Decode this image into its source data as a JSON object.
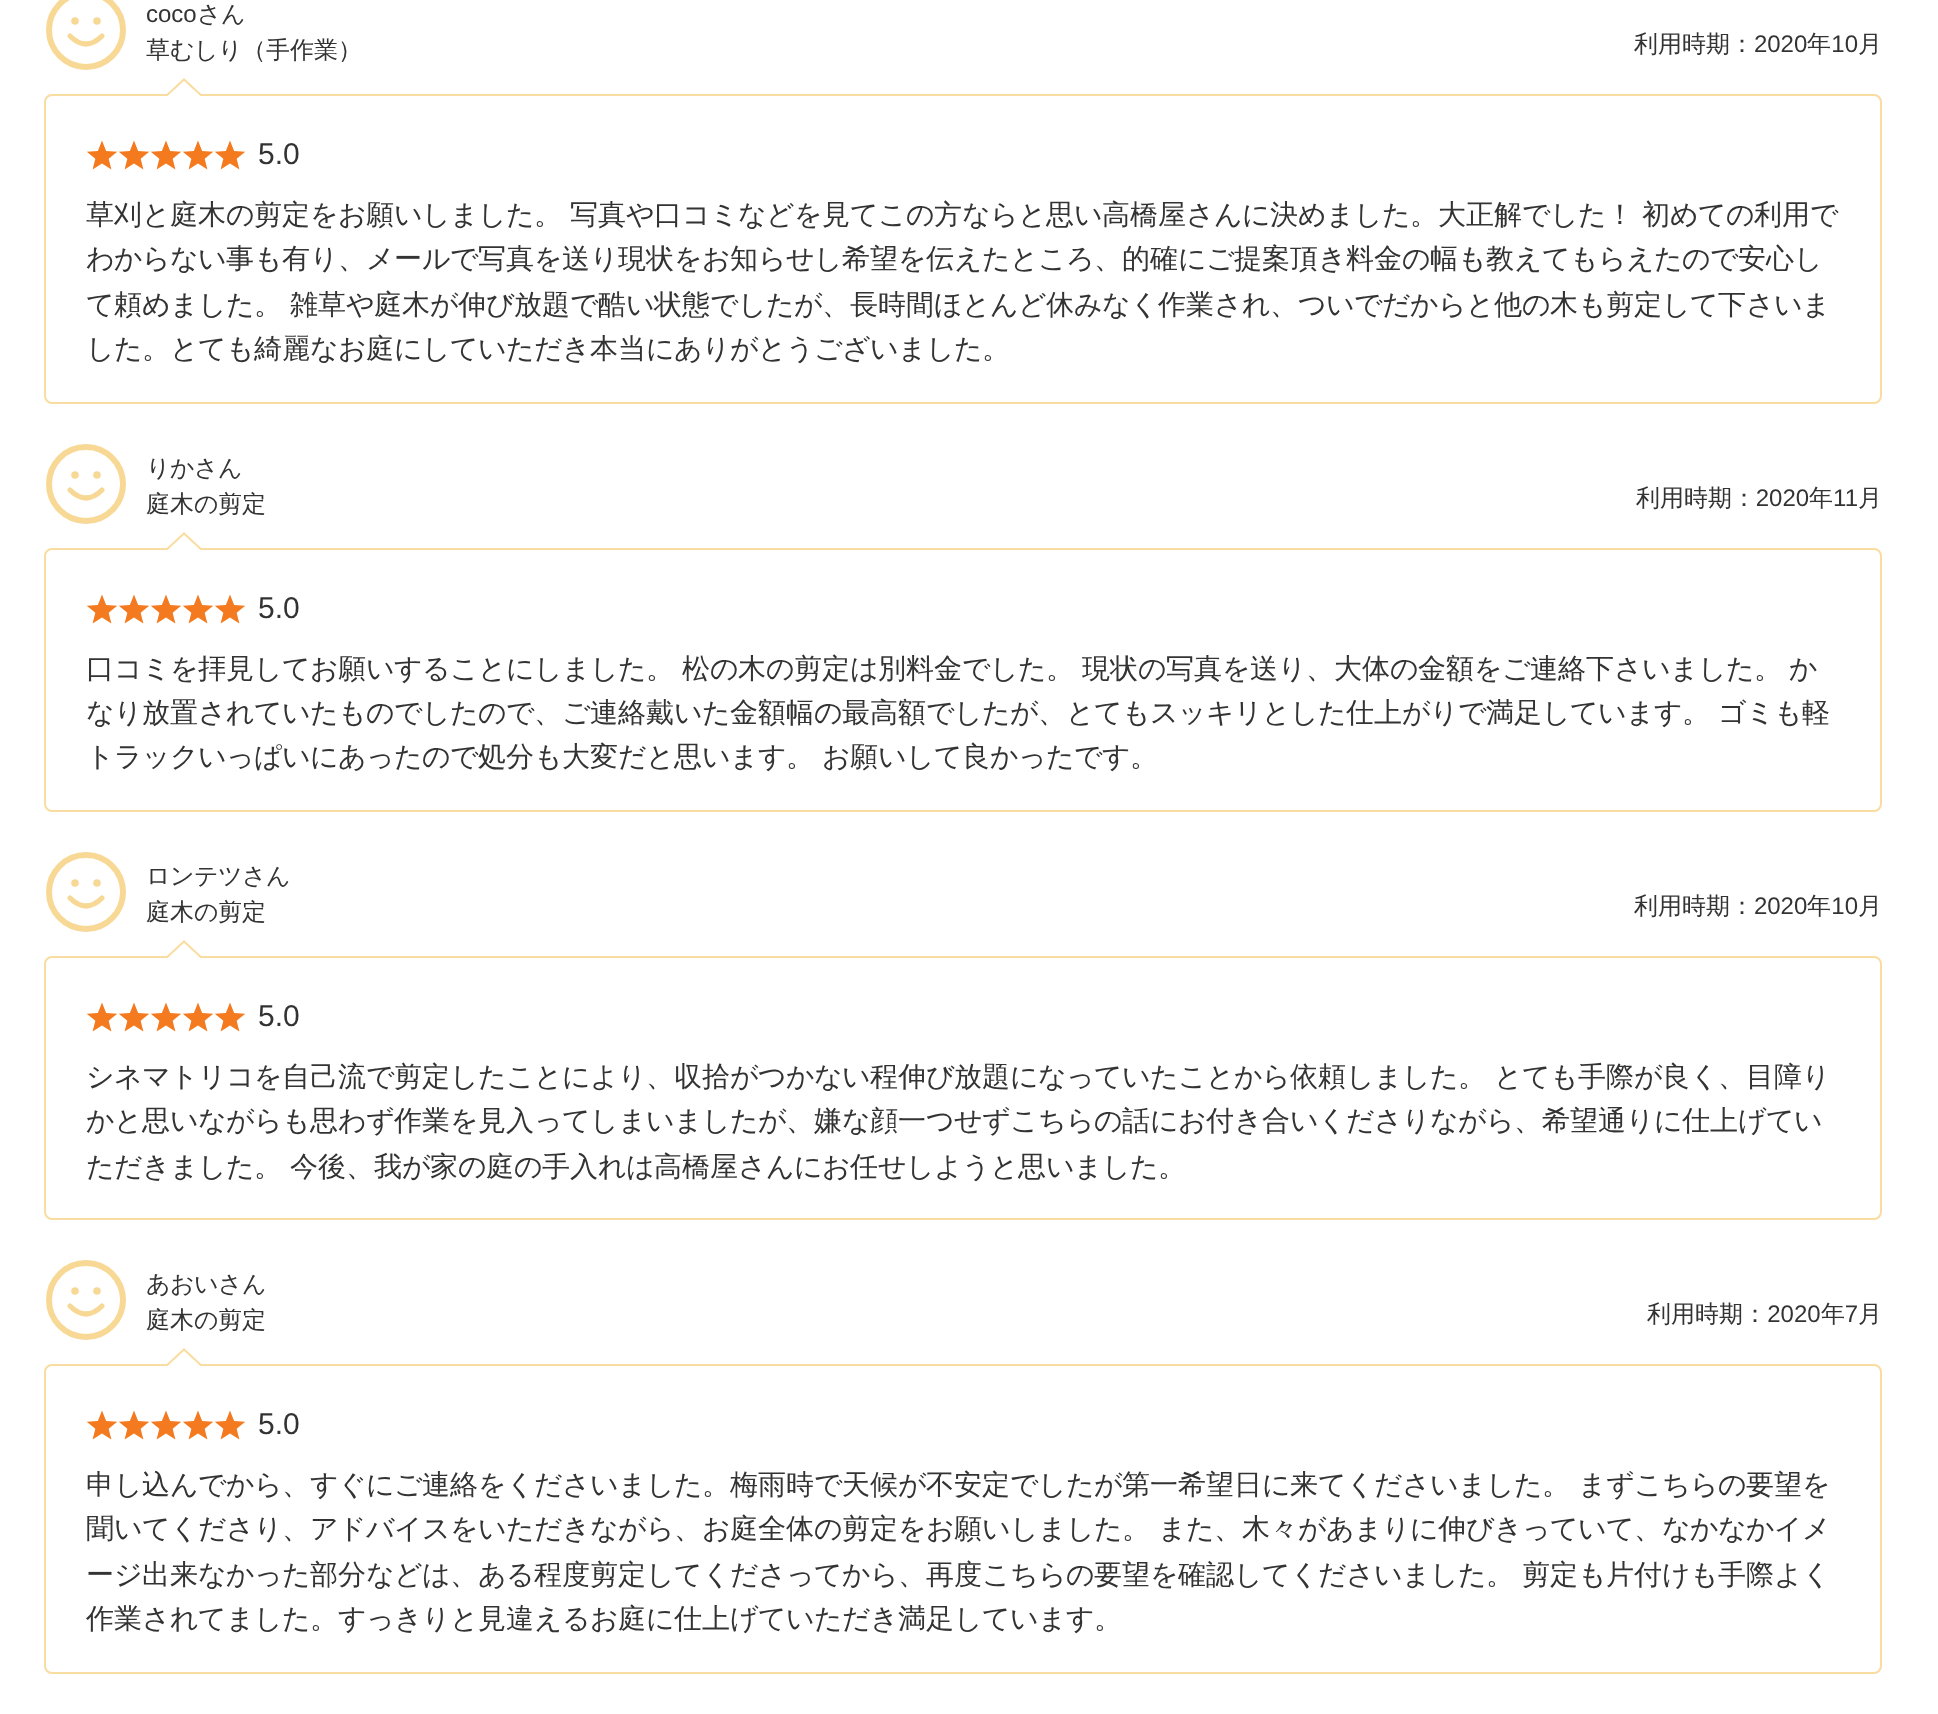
{
  "reviews": [
    {
      "reviewer": "cocoさん",
      "service": "草むしり（手作業）",
      "usage_period": "利用時期：2020年10月",
      "stars": 5,
      "score": "5.0",
      "comment": "草刈と庭木の剪定をお願いしました。 写真や口コミなどを見てこの方ならと思い高橋屋さんに決めました。大正解でした！ 初めての利用でわからない事も有り、メールで写真を送り現状をお知らせし希望を伝えたところ、的確にご提案頂き料金の幅も教えてもらえたので安心して頼めました。 雑草や庭木が伸び放題で酷い状態でしたが、長時間ほとんど休みなく作業され、ついでだからと他の木も剪定して下さいました。とても綺麗なお庭にしていただき本当にありがとうございました。"
    },
    {
      "reviewer": "りかさん",
      "service": "庭木の剪定",
      "usage_period": "利用時期：2020年11月",
      "stars": 5,
      "score": "5.0",
      "comment": "口コミを拝見してお願いすることにしました。 松の木の剪定は別料金でした。 現状の写真を送り、大体の金額をご連絡下さいました。 かなり放置されていたものでしたので、ご連絡戴いた金額幅の最高額でしたが、とてもスッキリとした仕上がりで満足しています。 ゴミも軽トラックいっぱいにあったので処分も大変だと思います。 お願いして良かったです。"
    },
    {
      "reviewer": "ロンテツさん",
      "service": "庭木の剪定",
      "usage_period": "利用時期：2020年10月",
      "stars": 5,
      "score": "5.0",
      "comment": "シネマトリコを自己流で剪定したことにより、収拾がつかない程伸び放題になっていたことから依頼しました。 とても手際が良く、目障りかと思いながらも思わず作業を見入ってしまいましたが、嫌な顔一つせずこちらの話にお付き合いくださりながら、希望通りに仕上げていただきました。 今後、我が家の庭の手入れは高橋屋さんにお任せしようと思いました。"
    },
    {
      "reviewer": "あおいさん",
      "service": "庭木の剪定",
      "usage_period": "利用時期：2020年7月",
      "stars": 5,
      "score": "5.0",
      "comment": "申し込んでから、すぐにご連絡をくださいました。梅雨時で天候が不安定でしたが第一希望日に来てくださいました。 まずこちらの要望を聞いてくださり、アドバイスをいただきながら、お庭全体の剪定をお願いしました。 また、木々があまりに伸びきっていて、なかなかイメージ出来なかった部分などは、ある程度剪定してくださってから、再度こちらの要望を確認してくださいました。 剪定も片付けも手際よく作業されてました。すっきりと見違えるお庭に仕上げていただき満足しています。"
    }
  ]
}
